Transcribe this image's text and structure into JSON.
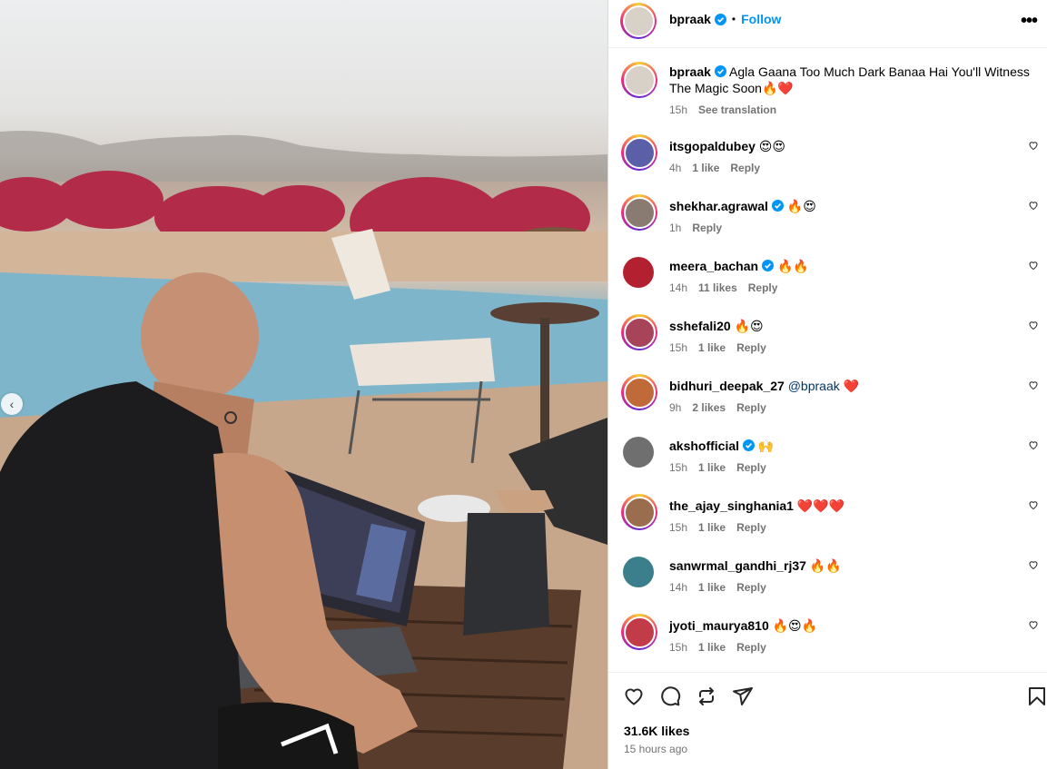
{
  "post": {
    "author": "bpraak",
    "follow_label": "Follow",
    "more_label": "•••",
    "caption_text": "Agla Gaana Too Much Dark Banaa Hai You'll Witness The Magic Soon",
    "caption_emojis": "🔥❤️",
    "caption_time": "15h",
    "see_translation": "See translation",
    "likes": "31.6K likes",
    "posted": "15 hours ago",
    "carousel_prev": "‹"
  },
  "comments": [
    {
      "user": "itsgopaldubey",
      "verified": false,
      "text": "",
      "emojis": "😍😍",
      "time": "4h",
      "likes": "1 like",
      "reply": "Reply",
      "avatar_color": "#5b5fa8"
    },
    {
      "user": "shekhar.agrawal",
      "verified": true,
      "text": "",
      "emojis": "🔥😍",
      "time": "1h",
      "likes": "",
      "reply": "Reply",
      "avatar_color": "#8a7b72"
    },
    {
      "user": "meera_bachan",
      "verified": true,
      "text": "",
      "emojis": "🔥🔥",
      "time": "14h",
      "likes": "11 likes",
      "reply": "Reply",
      "avatar_color": "#b32030"
    },
    {
      "user": "sshefali20",
      "verified": false,
      "text": "",
      "emojis": "🔥😍",
      "time": "15h",
      "likes": "1 like",
      "reply": "Reply",
      "avatar_color": "#a7445a"
    },
    {
      "user": "bidhuri_deepak_27",
      "verified": false,
      "text": "@bpraak",
      "emojis": "❤️",
      "time": "9h",
      "likes": "2 likes",
      "reply": "Reply",
      "avatar_color": "#c06a3a"
    },
    {
      "user": "akshofficial",
      "verified": true,
      "text": "",
      "emojis": "🙌",
      "time": "15h",
      "likes": "1 like",
      "reply": "Reply",
      "avatar_color": "#6f6f6f"
    },
    {
      "user": "the_ajay_singhania1",
      "verified": false,
      "text": "",
      "emojis": "❤️❤️❤️",
      "time": "15h",
      "likes": "1 like",
      "reply": "Reply",
      "avatar_color": "#9a6d4f"
    },
    {
      "user": "sanwrmal_gandhi_rj37",
      "verified": false,
      "text": "",
      "emojis": "🔥🔥",
      "time": "14h",
      "likes": "1 like",
      "reply": "Reply",
      "avatar_color": "#3c7f8c"
    },
    {
      "user": "jyoti_maurya810",
      "verified": false,
      "text": "",
      "emojis": "🔥😍🔥",
      "time": "15h",
      "likes": "1 like",
      "reply": "Reply",
      "avatar_color": "#c23b48"
    }
  ],
  "icons": {
    "like": "heart-icon",
    "comment": "comment-icon",
    "repost": "repost-icon",
    "share": "share-icon",
    "save": "bookmark-icon"
  },
  "colors": {
    "link_blue": "#0095f6",
    "verified_blue": "#0095f6",
    "muted": "#737373"
  }
}
